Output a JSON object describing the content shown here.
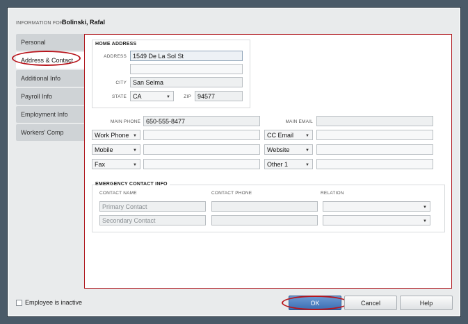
{
  "header": {
    "info_label": "INFORMATION FOR",
    "employee_name": "Bolinski, Rafal"
  },
  "tabs": [
    {
      "label": "Personal",
      "active": false
    },
    {
      "label": "Address & Contact",
      "active": true
    },
    {
      "label": "Additional Info",
      "active": false
    },
    {
      "label": "Payroll Info",
      "active": false
    },
    {
      "label": "Employment Info",
      "active": false
    },
    {
      "label": "Workers' Comp",
      "active": false
    }
  ],
  "home_address": {
    "title": "HOME ADDRESS",
    "address_label": "ADDRESS",
    "address_line1": "1549 De La Sol St",
    "address_line2": "",
    "city_label": "CITY",
    "city": "San Selma",
    "state_label": "STATE",
    "state": "CA",
    "zip_label": "ZIP",
    "zip": "94577"
  },
  "contact": {
    "main_phone_label": "MAIN PHONE",
    "main_phone": "650-555-8477",
    "main_email_label": "MAIN EMAIL",
    "main_email": "",
    "rows": [
      {
        "left_type": "Work Phone",
        "left_value": "",
        "right_type": "CC Email",
        "right_value": ""
      },
      {
        "left_type": "Mobile",
        "left_value": "",
        "right_type": "Website",
        "right_value": ""
      },
      {
        "left_type": "Fax",
        "left_value": "",
        "right_type": "Other 1",
        "right_value": ""
      }
    ]
  },
  "emergency": {
    "title": "EMERGENCY CONTACT INFO",
    "col_name": "CONTACT NAME",
    "col_phone": "CONTACT PHONE",
    "col_relation": "RELATION",
    "primary_placeholder": "Primary Contact",
    "secondary_placeholder": "Secondary Contact"
  },
  "footer": {
    "inactive_label": "Employee is inactive",
    "ok_label": "OK",
    "cancel_label": "Cancel",
    "help_label": "Help"
  },
  "colors": {
    "highlight": "#b8151c",
    "ok_button": "#3c6eb3",
    "panel_border": "#b01a20"
  }
}
